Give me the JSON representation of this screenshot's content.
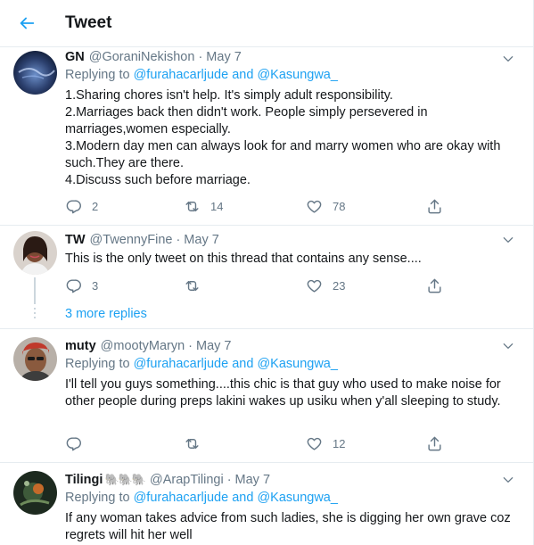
{
  "header": {
    "title": "Tweet"
  },
  "tweets": [
    {
      "name": "GN",
      "handle": "@GoraniNekishon",
      "date": "May 7",
      "replying_prefix": "Replying to ",
      "replying_to": "@furahacarljude and @Kasungwa_",
      "lines": [
        "1.Sharing chores isn't help. It's simply adult responsibility.",
        "2.Marriages back then didn't work. People simply persevered in marriages,women especially.",
        "3.Modern day men can always look for and marry women who are okay with such.They are there.",
        "4.Discuss such before marriage."
      ],
      "replies": "2",
      "retweets": "14",
      "likes": "78"
    },
    {
      "name": "TW",
      "handle": "@TwennyFine",
      "date": "May 7",
      "lines": [
        "This is the only tweet on this thread that contains any sense...."
      ],
      "replies": "3",
      "retweets": "",
      "likes": "23"
    },
    {
      "name": "muty",
      "handle": "@mootyMaryn",
      "date": "May 7",
      "replying_prefix": "Replying to ",
      "replying_to": "@furahacarljude and @Kasungwa_",
      "lines": [
        "I'll tell you guys something....this chic is that guy who used to make noise for other people during preps lakini wakes up usiku when y'all sleeping to study."
      ],
      "replies": "",
      "retweets": "",
      "likes": "12"
    },
    {
      "name": "Tilingi",
      "emoji": "🐘🐘🐘",
      "handle": "@ArapTilingi",
      "date": "May 7",
      "replying_prefix": "Replying to ",
      "replying_to": "@furahacarljude and @Kasungwa_",
      "lines": [
        "If any woman takes advice from such ladies, she is digging her own grave coz regrets will hit her well"
      ]
    }
  ],
  "more_replies": "3 more replies",
  "separator": "·",
  "colors": {
    "accent": "#1da1f2",
    "secondary_text": "#657786",
    "border": "#e6ecf0"
  }
}
